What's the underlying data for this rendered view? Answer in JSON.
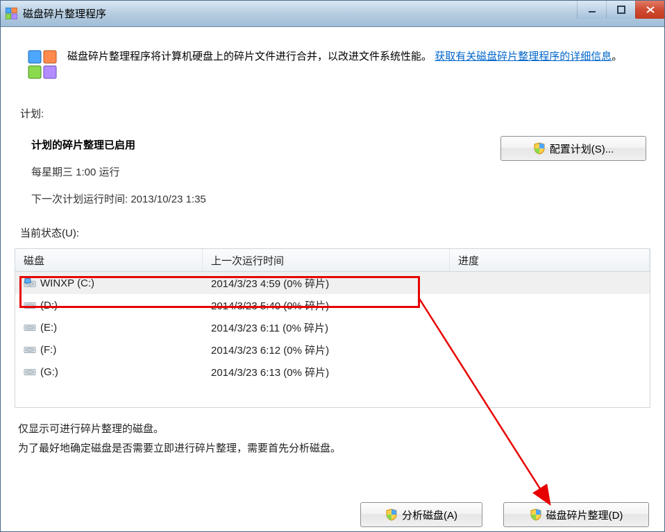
{
  "window": {
    "title": "磁盘碎片整理程序"
  },
  "intro": {
    "text_prefix": "磁盘碎片整理程序将计算机硬盘上的碎片文件进行合并，以改进文件系统性能。",
    "link": "获取有关磁盘碎片整理程序的详细信息",
    "period": "。"
  },
  "schedule": {
    "section": "计划:",
    "enabled": "计划的碎片整理已启用",
    "every": "每星期三   1:00 运行",
    "next": "下一次计划运行时间: 2013/10/23 1:35",
    "config_btn": "配置计划(S)..."
  },
  "status": {
    "section": "当前状态(U):"
  },
  "table": {
    "cols": {
      "disk": "磁盘",
      "last": "上一次运行时间",
      "prog": "进度"
    },
    "rows": [
      {
        "name": "WINXP (C:)",
        "last": "2014/3/23 4:59 (0% 碎片)",
        "icon": "os",
        "selected": true
      },
      {
        "name": "(D:)",
        "last": "2014/3/23 5:40 (0% 碎片)",
        "icon": "drive",
        "selected": false
      },
      {
        "name": "(E:)",
        "last": "2014/3/23 6:11 (0% 碎片)",
        "icon": "drive",
        "selected": false
      },
      {
        "name": "(F:)",
        "last": "2014/3/23 6:12 (0% 碎片)",
        "icon": "drive",
        "selected": false
      },
      {
        "name": "(G:)",
        "last": "2014/3/23 6:13 (0% 碎片)",
        "icon": "drive",
        "selected": false
      }
    ]
  },
  "note": {
    "line1": "仅显示可进行碎片整理的磁盘。",
    "line2": "为了最好地确定磁盘是否需要立即进行碎片整理，需要首先分析磁盘。"
  },
  "buttons": {
    "analyze": "分析磁盘(A)",
    "defrag": "磁盘碎片整理(D)"
  }
}
